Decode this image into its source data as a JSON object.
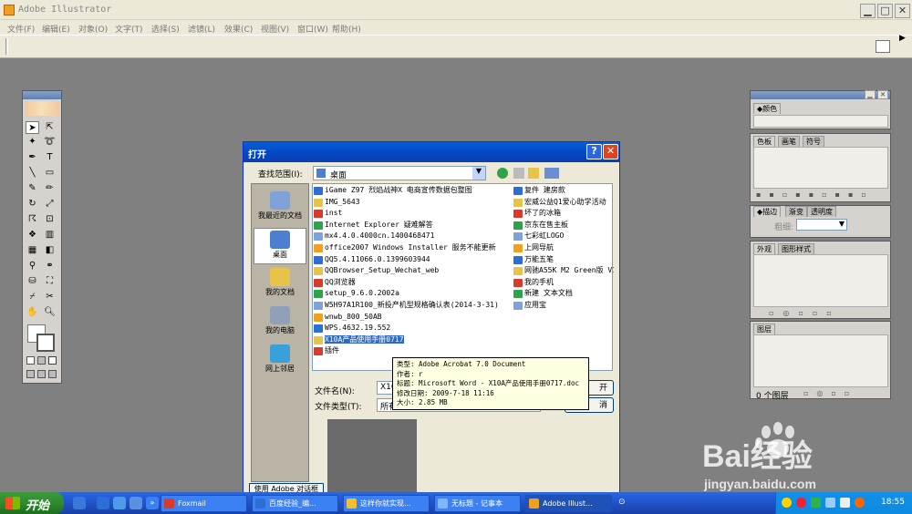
{
  "app": {
    "title": "Adobe Illustrator"
  },
  "menu": [
    "文件(F)",
    "编辑(E)",
    "对象(O)",
    "文字(T)",
    "选择(S)",
    "滤镜(L)",
    "效果(C)",
    "视图(V)",
    "窗口(W)",
    "帮助(H)"
  ],
  "panels": {
    "color": {
      "tab": "颜色"
    },
    "swatches": {
      "tabs": [
        "色板",
        "画笔",
        "符号"
      ]
    },
    "stroke": {
      "tabs": [
        "描边",
        "渐变",
        "透明度"
      ],
      "weight_label": "粗细:"
    },
    "appearance": {
      "tabs": [
        "外观",
        "图形样式"
      ]
    },
    "layers": {
      "tab": "图层",
      "status": "0 个图层"
    }
  },
  "dialog": {
    "title": "打开",
    "lookin_label": "查找范围(I):",
    "lookin_value": "桌面",
    "places": [
      "我最近的文档",
      "桌面",
      "我的文档",
      "我的电脑",
      "网上邻居"
    ],
    "files_left": [
      "iGame Z97 烈焰战神X 电商宣传数据包整图",
      "IMG_5643",
      "inst",
      "Internet Explorer 疑难解答",
      "mx4.4.0.4000cn.1400468471",
      "office2007 Windows Installer 服务不能更新",
      "QQ5.4.11066.0.1399603944",
      "QQBrowser_Setup_Wechat_web",
      "QQ浏览器",
      "setup_9.6.0.2002a",
      "W5H97A1R100_新投产机型规格确认表(2014-3-31)",
      "wnwb_800_50AB",
      "WPS.4632.19.552",
      "X10A产品使用手册0717",
      "插件"
    ],
    "files_right": [
      "复件 建房款",
      "宏威公益Q1爱心助学活动",
      "坏了的冰箱",
      "京东在售主板",
      "七彩虹LOGO",
      "上网导航",
      "万能五笔",
      "网驰A55K M2 Green版 V1",
      "我的手机",
      "新建 文本文档",
      "应用宝"
    ],
    "selected_index": 13,
    "filename_label": "文件名(N):",
    "filename_value": "X10A",
    "filetype_label": "文件类型(T):",
    "filetype_value": "所有",
    "open_button": "开",
    "cancel_button": "消",
    "use_adobe_dialog": "使用 Adobe 对话框"
  },
  "tooltip": [
    "类型: Adobe Acrobat 7.0 Document",
    "作者: r",
    "标题: Microsoft Word - X10A产品使用手册0717.doc",
    "修改日期: 2009-7-18 11:16",
    "大小: 2.85 MB"
  ],
  "taskbar": {
    "start": "开始",
    "tasks": [
      "Foxmail",
      "百度经验_编...",
      "这样你就实现...",
      "无标题 - 记事本",
      "Adobe Illust..."
    ],
    "clock": "18:55"
  },
  "watermark": {
    "logo": "Bai经验",
    "url": "jingyan.baidu.com"
  }
}
